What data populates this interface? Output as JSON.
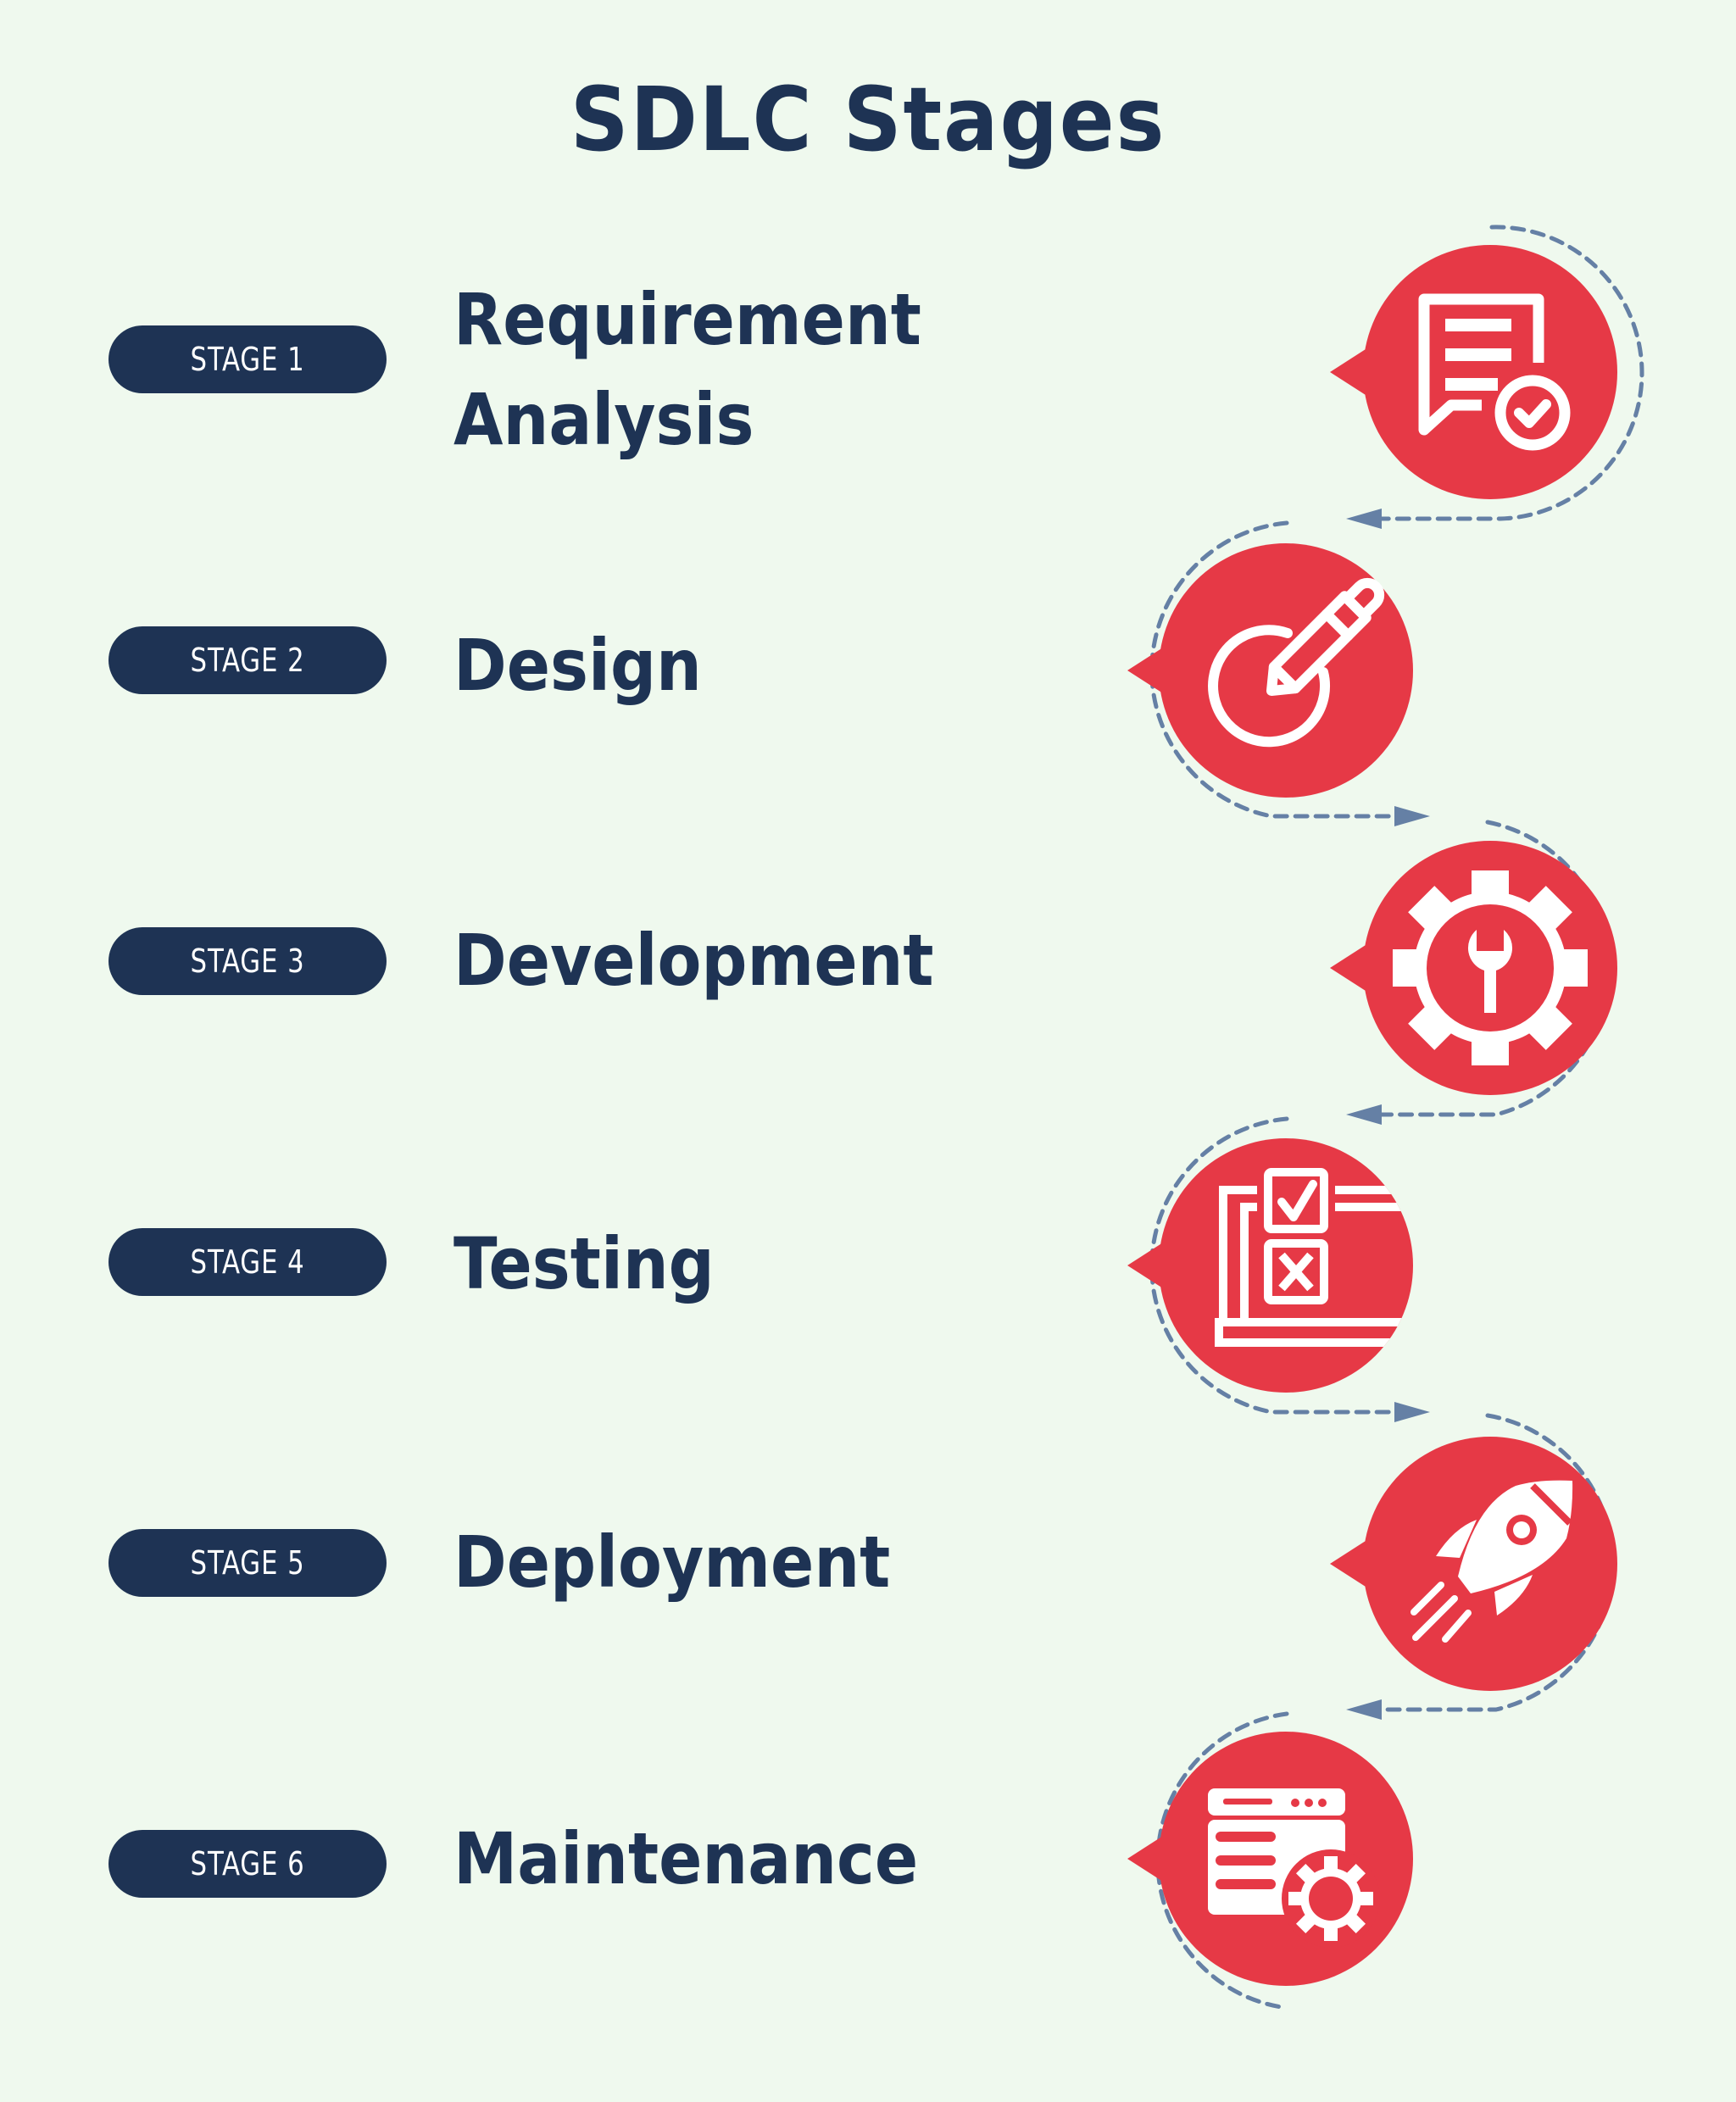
{
  "title": "SDLC Stages",
  "colors": {
    "background": "#eff9ee",
    "navy": "#1e3354",
    "red": "#e63946",
    "connector": "#6580a5",
    "icon": "#ffffff"
  },
  "stages": [
    {
      "badge": "STAGE 1",
      "name": "Requirement\nAnalysis",
      "icon": "document-check-icon"
    },
    {
      "badge": "STAGE 2",
      "name": "Design",
      "icon": "pencil-circle-icon"
    },
    {
      "badge": "STAGE 3",
      "name": "Development",
      "icon": "gear-wrench-icon"
    },
    {
      "badge": "STAGE 4",
      "name": "Testing",
      "icon": "checklist-laptop-icon"
    },
    {
      "badge": "STAGE 5",
      "name": "Deployment",
      "icon": "rocket-icon"
    },
    {
      "badge": "STAGE 6",
      "name": "Maintenance",
      "icon": "browser-gear-icon"
    }
  ]
}
